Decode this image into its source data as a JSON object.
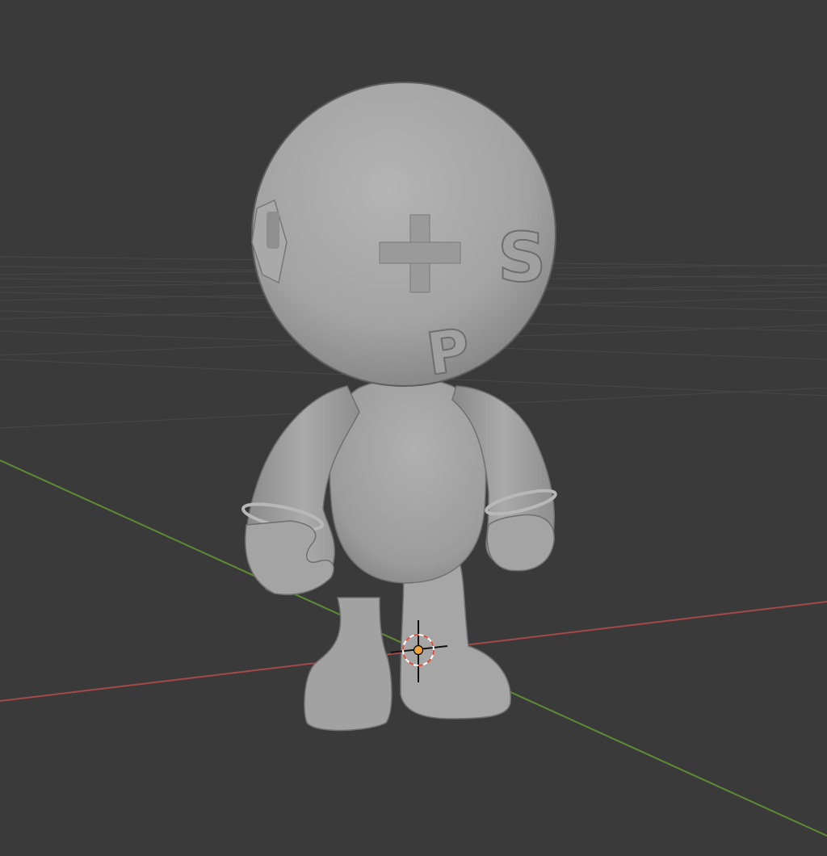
{
  "viewport": {
    "background_color": "#3a3a3a",
    "grid_color": "#4a4a4a",
    "x_axis_color": "#b34b4b",
    "y_axis_color": "#6a9a3a",
    "model_color": "#a6a6a6",
    "cursor_ring_color": "#ff6a5a",
    "origin_dot_color": "#f0a030"
  },
  "model": {
    "head_symbols": [
      {
        "name": "plus",
        "char": "+"
      },
      {
        "name": "letter-s",
        "char": "S"
      },
      {
        "name": "letter-p",
        "char": "P"
      }
    ]
  },
  "icons": [
    "3d-cursor-icon",
    "origin-point-icon"
  ]
}
